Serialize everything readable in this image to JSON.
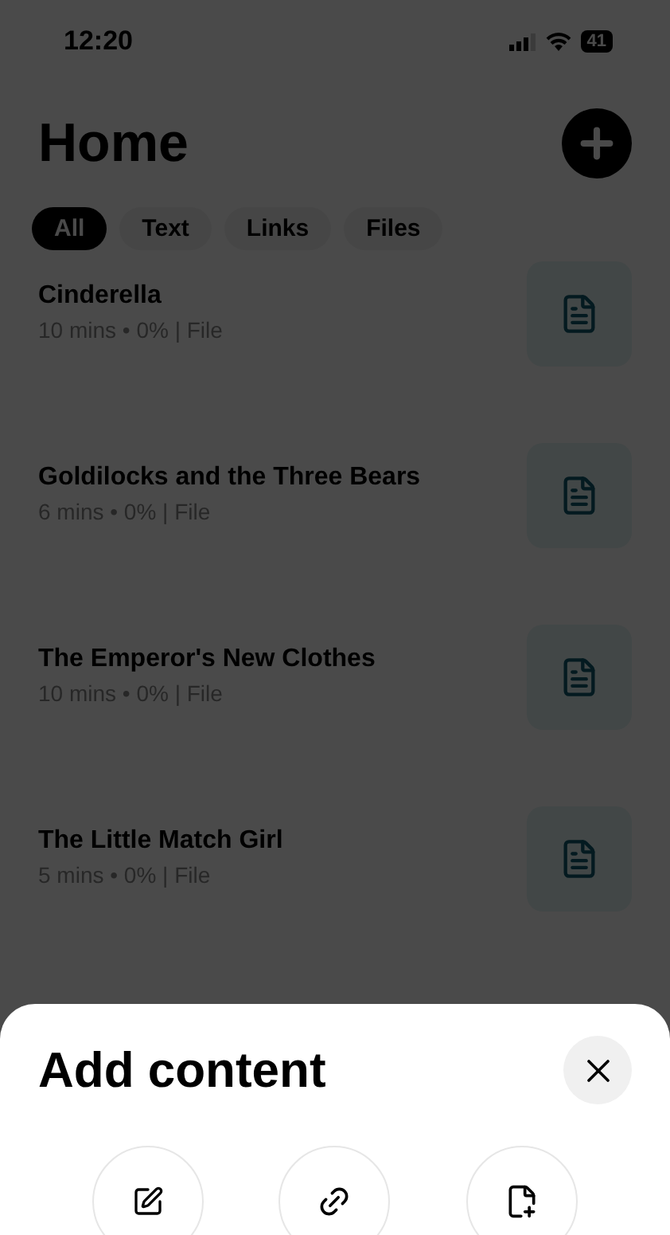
{
  "status_bar": {
    "time": "12:20",
    "battery": "41"
  },
  "header": {
    "title": "Home"
  },
  "filters": [
    {
      "label": "All",
      "selected": true
    },
    {
      "label": "Text",
      "selected": false
    },
    {
      "label": "Links",
      "selected": false
    },
    {
      "label": "Files",
      "selected": false
    }
  ],
  "items": [
    {
      "title": "Cinderella",
      "meta": "10 mins • 0% | File"
    },
    {
      "title": "Goldilocks and the Three Bears",
      "meta": "6 mins • 0% | File"
    },
    {
      "title": "The Emperor's New Clothes",
      "meta": "10 mins • 0% | File"
    },
    {
      "title": "The Little Match Girl",
      "meta": "5 mins • 0% | File"
    }
  ],
  "sheet": {
    "title": "Add content",
    "options": [
      {
        "kind": "text"
      },
      {
        "kind": "link"
      },
      {
        "kind": "file"
      }
    ]
  }
}
